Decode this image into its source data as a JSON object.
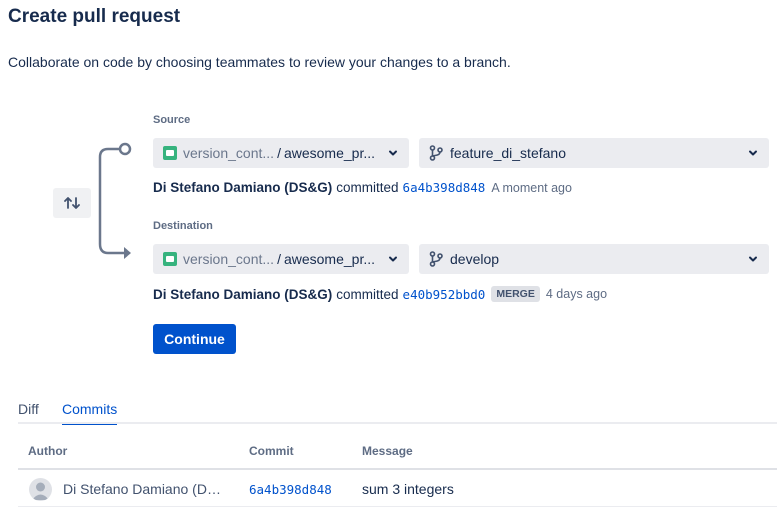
{
  "page": {
    "title": "Create pull request",
    "description": "Collaborate on code by choosing teammates to review your changes to a branch."
  },
  "source": {
    "label": "Source",
    "workspace": "version_cont...",
    "repository": "awesome_pr...",
    "branch": "feature_di_stefano",
    "commit": {
      "author": "Di Stefano Damiano (DS&G)",
      "verb": "committed",
      "hash": "6a4b398d848",
      "time": "A moment ago"
    }
  },
  "destination": {
    "label": "Destination",
    "workspace": "version_cont...",
    "repository": "awesome_pr...",
    "branch": "develop",
    "commit": {
      "author": "Di Stefano Damiano (DS&G)",
      "verb": "committed",
      "hash": "e40b952bbd0",
      "badge": "MERGE",
      "time": "4 days ago"
    }
  },
  "separator": "/",
  "actions": {
    "swap_icon": "swap-arrows-icon",
    "continue_label": "Continue"
  },
  "tabs": [
    {
      "label": "Diff",
      "active": false
    },
    {
      "label": "Commits",
      "active": true
    }
  ],
  "commits_table": {
    "columns": [
      "Author",
      "Commit",
      "Message"
    ],
    "rows": [
      {
        "author": "Di Stefano Damiano (DS&G)",
        "hash": "6a4b398d848",
        "message": "sum 3 integers"
      }
    ]
  },
  "colors": {
    "primary": "#0052cc",
    "text": "#172b4d",
    "muted": "#5e6c84",
    "select_bg": "#ebecf0",
    "repo_icon": "#36b37e"
  }
}
